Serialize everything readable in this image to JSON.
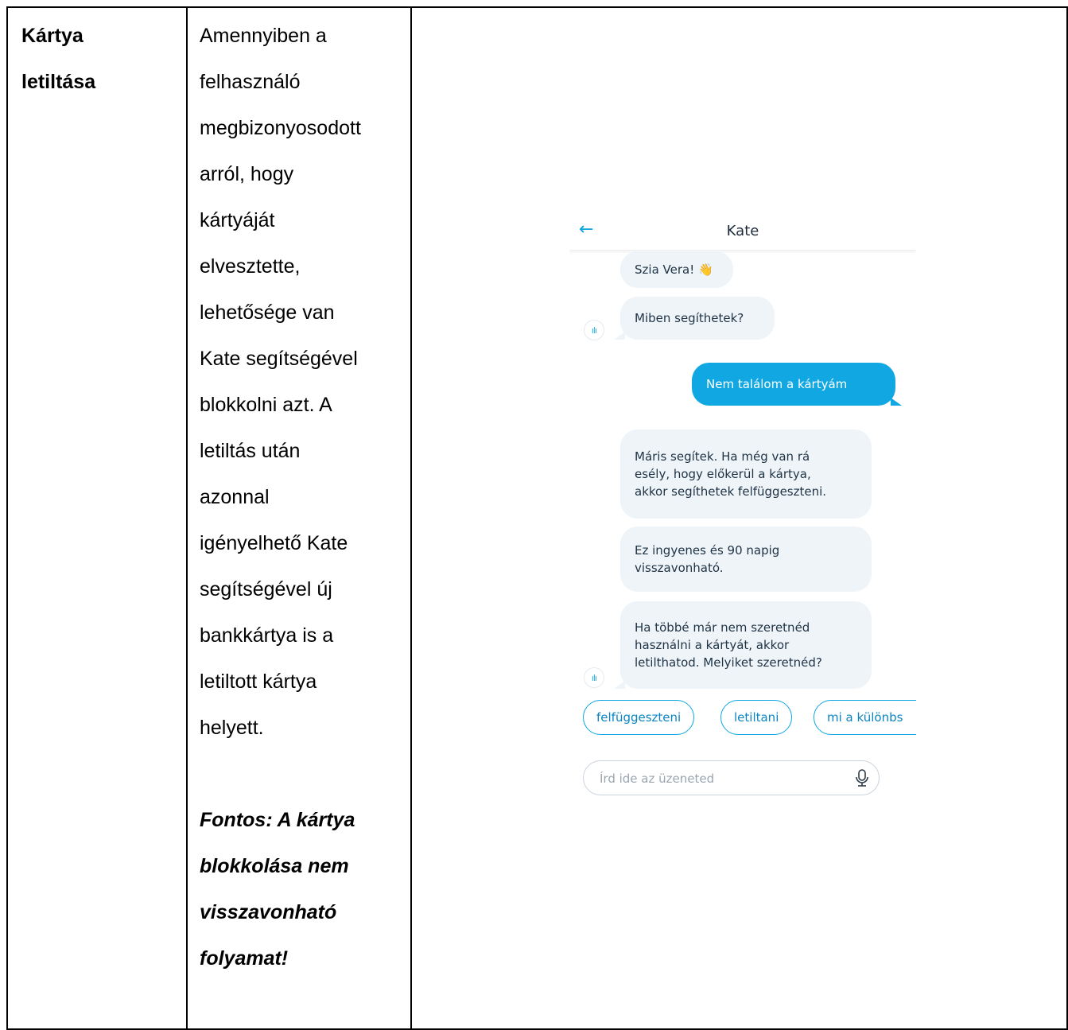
{
  "table": {
    "feature_title_lines": [
      "Kártya",
      "letiltása"
    ],
    "description_lines": [
      "Amennyiben a",
      "felhasználó",
      "megbizonyosodott",
      "arról, hogy",
      "kártyáját",
      "elvesztette,",
      "lehetősége van",
      "Kate segítségével",
      "blokkolni azt. A",
      "letiltás után",
      "azonnal",
      "igényelhető Kate",
      "segítségével új",
      "bankkártya is a",
      "letiltott kártya",
      "helyett."
    ],
    "note_lines": [
      "Fontos: A kártya",
      "blokkolása nem",
      "visszavonható",
      "folyamat!"
    ]
  },
  "chat": {
    "header_title": "Kate",
    "back_icon": "arrow-left-icon",
    "messages": [
      {
        "sender": "bot",
        "text": "Szia Vera! 👋"
      },
      {
        "sender": "bot",
        "text": "Miben segíthetek?"
      },
      {
        "sender": "user",
        "text": "Nem találom a kártyám"
      },
      {
        "sender": "bot",
        "lines": [
          "Máris segítek. Ha még van rá",
          "esély, hogy előkerül a kártya,",
          "akkor segíthetek felfüggeszteni."
        ]
      },
      {
        "sender": "bot",
        "lines": [
          "Ez ingyenes és 90 napig",
          "visszavonható."
        ]
      },
      {
        "sender": "bot",
        "lines": [
          "Ha többé már nem szeretnéd",
          "használni a kártyát, akkor",
          "letilthatod. Melyiket szeretnéd?"
        ]
      }
    ],
    "quick_replies": [
      "felfüggeszteni",
      "letiltani",
      "mi a különbs"
    ],
    "input_placeholder": "Írd ide az üzeneted",
    "colors": {
      "accent": "#10a7e3",
      "bot_bubble": "#eef4f8",
      "text": "#1f3346"
    }
  }
}
